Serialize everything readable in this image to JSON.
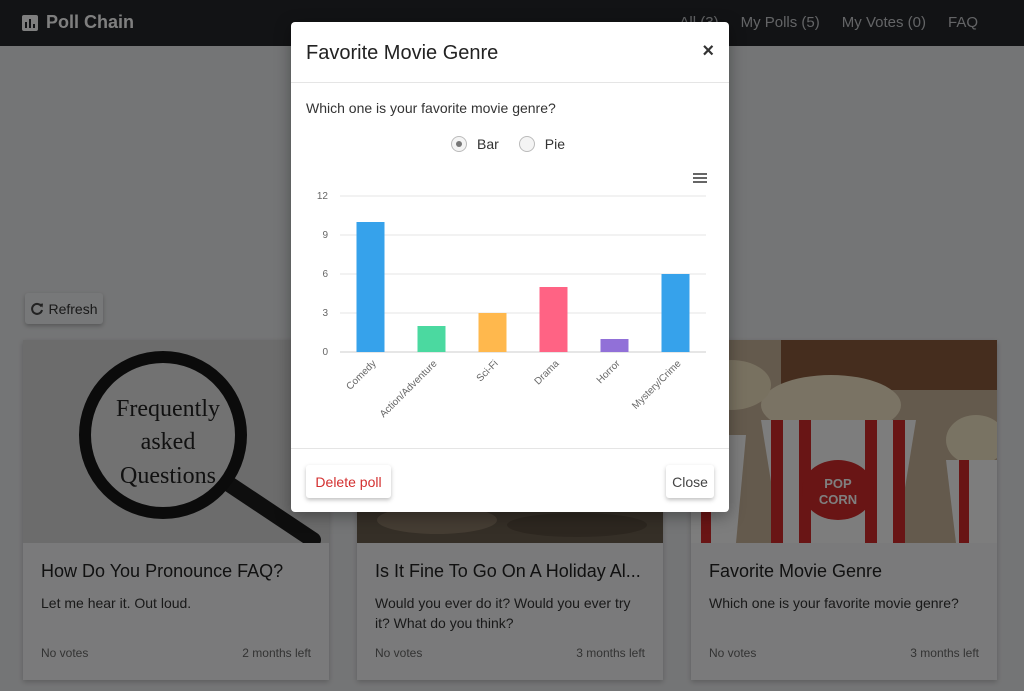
{
  "app": {
    "name": "Poll Chain"
  },
  "nav": {
    "all": "All (3)",
    "my_polls": "My Polls (5)",
    "my_votes": "My Votes (0)",
    "faq": "FAQ"
  },
  "toolbar": {
    "refresh_label": "Refresh"
  },
  "cards": [
    {
      "title": "How Do You Pronounce FAQ?",
      "description": "Let me hear it. Out loud.",
      "votes": "No votes",
      "time_left": "2 months left",
      "image_text": [
        "Frequently",
        "asked",
        "Questions"
      ]
    },
    {
      "title": "Is It Fine To Go On A Holiday Al...",
      "description": "Would you ever do it? Would you ever try it? What do you think?",
      "votes": "No votes",
      "time_left": "3 months left"
    },
    {
      "title": "Favorite Movie Genre",
      "description": "Which one is your favorite movie genre?",
      "votes": "No votes",
      "time_left": "3 months left",
      "image_text": [
        "POP",
        "CORN"
      ]
    }
  ],
  "modal": {
    "title": "Favorite Movie Genre",
    "close_icon": "×",
    "question": "Which one is your favorite movie genre?",
    "chart_options": [
      "Bar",
      "Pie"
    ],
    "selected_chart": "Bar",
    "delete_label": "Delete poll",
    "close_label": "Close"
  },
  "chart_data": {
    "type": "bar",
    "categories": [
      "Comedy",
      "Action/Adventure",
      "Sci-Fi",
      "Drama",
      "Horror",
      "Mystery/Crime"
    ],
    "values": [
      10,
      2,
      3,
      5,
      1,
      6
    ],
    "colors": [
      "#36a2eb",
      "#4bd9a0",
      "#ffb84d",
      "#ff6384",
      "#9170d8",
      "#36a2eb"
    ],
    "yticks": [
      0,
      3,
      6,
      9,
      12
    ],
    "ylim": [
      0,
      12
    ],
    "grid": true
  }
}
